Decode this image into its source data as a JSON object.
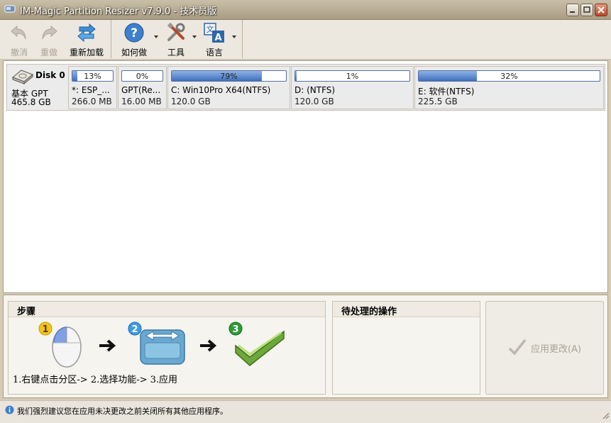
{
  "window": {
    "title": "IM-Magic Partition Resizer v7.9.0 - 技术员版"
  },
  "toolbar": {
    "undo_label": "撤消",
    "redo_label": "重做",
    "reload_label": "重新加载",
    "howto_label": "如何做",
    "tools_label": "工具",
    "language_label": "语言"
  },
  "disk": {
    "name": "Disk 0",
    "type": "基本 GPT",
    "size": "465.8 GB",
    "partitions": [
      {
        "label": "*: ESP_...",
        "size": "266.0 MB",
        "used_pct": "13%",
        "used": 0.13
      },
      {
        "label": "GPT(Re...",
        "size": "16.00 MB",
        "used_pct": "0%",
        "used": 0.0
      },
      {
        "label": "C: Win10Pro X64(NTFS)",
        "size": "120.0 GB",
        "used_pct": "79%",
        "used": 0.79
      },
      {
        "label": "D: (NTFS)",
        "size": "120.0 GB",
        "used_pct": "1%",
        "used": 0.01
      },
      {
        "label": "E: 软件(NTFS)",
        "size": "225.5 GB",
        "used_pct": "32%",
        "used": 0.32
      }
    ]
  },
  "steps": {
    "title": "步骤",
    "caption": "1.右键点击分区-> 2.选择功能-> 3.应用",
    "badge1": "1",
    "badge2": "2",
    "badge3": "3"
  },
  "pending": {
    "title": "待处理的操作"
  },
  "apply": {
    "label": "应用更改(A)"
  },
  "status": {
    "text": "我们强烈建议您在应用未决更改之前关闭所有其他应用程序。"
  }
}
